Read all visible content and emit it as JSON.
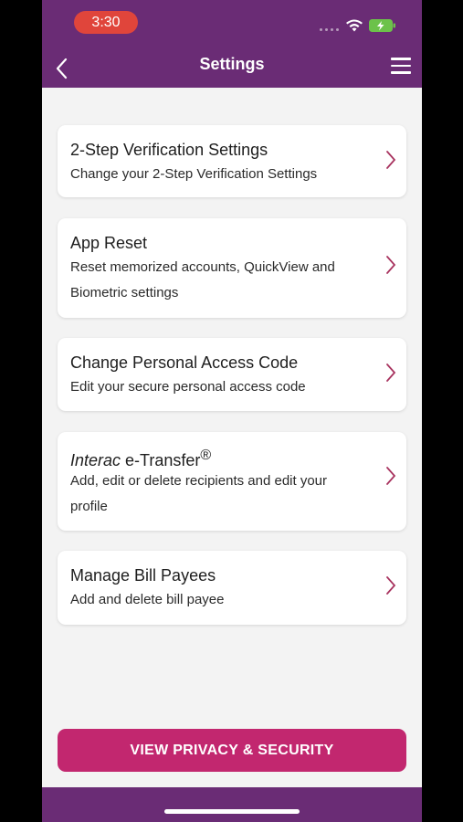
{
  "status_bar": {
    "time": "3:30"
  },
  "header": {
    "title": "Settings"
  },
  "cards": [
    {
      "title": "2-Step Verification Settings",
      "subtitle": "Change your 2-Step Verification Settings"
    },
    {
      "title": "App Reset",
      "subtitle": "Reset memorized accounts, QuickView and Biometric settings"
    },
    {
      "title": "Change Personal Access Code",
      "subtitle": "Edit your secure personal access code"
    },
    {
      "title_italic": "Interac",
      "title_rest": " e-Transfer",
      "title_mark": "®",
      "subtitle": "Add, edit or delete recipients and edit your profile"
    },
    {
      "title": "Manage Bill Payees",
      "subtitle": "Add and delete bill payee"
    }
  ],
  "footer": {
    "button_label": "VIEW PRIVACY & SECURITY"
  },
  "colors": {
    "brand_purple": "#6a2c75",
    "accent_pink": "#c2276f",
    "status_red": "#e0453b"
  }
}
